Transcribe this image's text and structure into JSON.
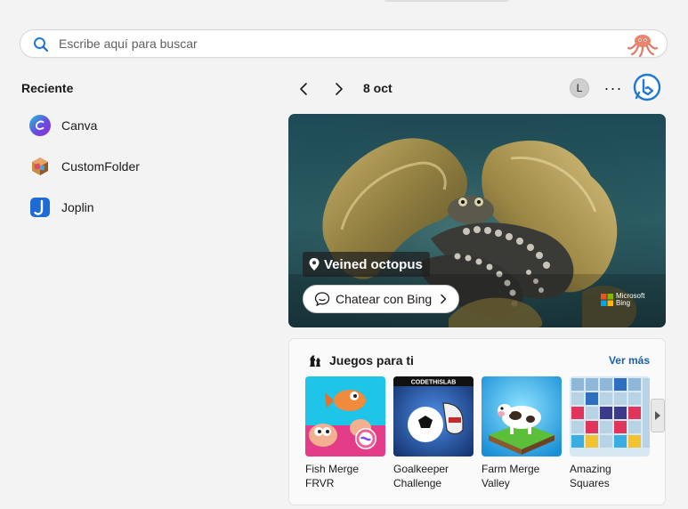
{
  "search": {
    "placeholder": "Escribe aquí para buscar",
    "icon": "search-icon"
  },
  "recent": {
    "title": "Reciente",
    "items": [
      {
        "label": "Canva",
        "icon": "canva-icon"
      },
      {
        "label": "CustomFolder",
        "icon": "custom-folder-icon"
      },
      {
        "label": "Joplin",
        "icon": "joplin-icon"
      }
    ]
  },
  "header": {
    "date": "8 oct",
    "avatar": "L",
    "more": "···"
  },
  "hero": {
    "caption": "Veined octopus",
    "chat_label": "Chatear con Bing",
    "brand_line1": "Microsoft",
    "brand_line2": "Bing"
  },
  "games": {
    "title": "Juegos para ti",
    "see_more": "Ver más",
    "cards": [
      {
        "line1": "Fish Merge",
        "line2": "FRVR"
      },
      {
        "line1": "Goalkeeper",
        "line2": "Challenge",
        "badge": "CODETHISLAB"
      },
      {
        "line1": "Farm Merge",
        "line2": "Valley"
      },
      {
        "line1": "Amazing",
        "line2": "Squares"
      }
    ]
  },
  "colors": {
    "accent": "#1a5fa8",
    "bing_blue": "#1f78d1"
  }
}
